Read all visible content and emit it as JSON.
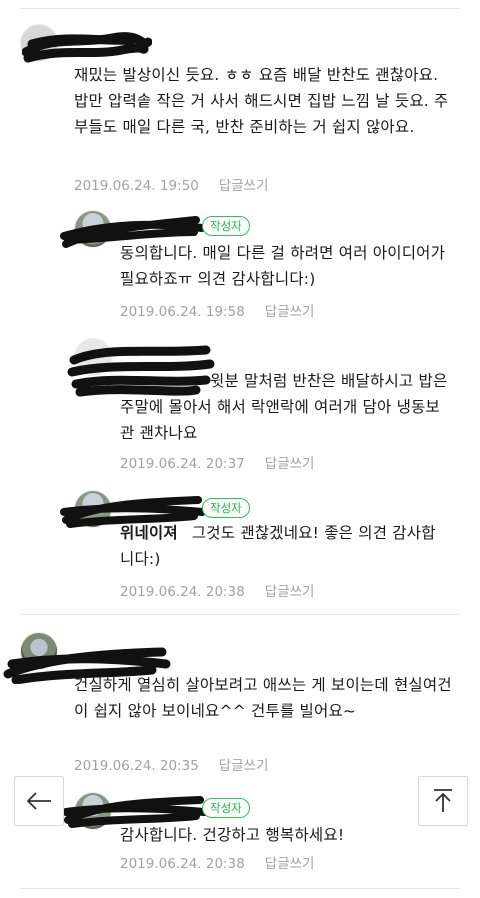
{
  "comments": [
    {
      "text": "재밌는 발상이신 듯요. ㅎㅎ 요즘 배달 반찬도 괜찮아요. 밥만 압력솥 작은 거 사서 해드시면 집밥 느낌 날 듯요. 주부들도 매일 다른 국, 반찬 준비하는 거 쉽지 않아요.",
      "date": "2019.06.24. 19:50",
      "reply_label": "답글쓰기"
    },
    {
      "badge": "작성자",
      "text": "동의합니다. 매일 다른 걸 하려면 여러 아이디어가 필요하죠ㅠ 의견 감사합니다:)",
      "date": "2019.06.24. 19:58",
      "reply_label": "답글쓰기"
    },
    {
      "text": "윗분 말처럼 반찬은 배달하시고 밥은 주말에 몰아서 해서 락앤락에 여러개 담아 냉동보관 괜차나요",
      "date": "2019.06.24. 20:37",
      "reply_label": "답글쓰기"
    },
    {
      "badge": "작성자",
      "author": "위네이져",
      "text": "그것도 괜찮겠네요! 좋은 의견 감사합니다:)",
      "date": "2019.06.24. 20:38",
      "reply_label": "답글쓰기"
    },
    {
      "text": "건실하게 열심히 살아보려고 애쓰는 게 보이는데 현실여건이 쉽지 않아 보이네요^^ 건투를 빌어요~",
      "date": "2019.06.24. 20:35",
      "reply_label": "답글쓰기"
    },
    {
      "badge": "작성자",
      "text": "감사합니다. 건강하고 행복하세요!",
      "date": "2019.06.24. 20:38",
      "reply_label": "답글쓰기"
    }
  ],
  "icons": {
    "back": "arrow-left-icon",
    "top": "arrow-up-to-top-icon"
  }
}
